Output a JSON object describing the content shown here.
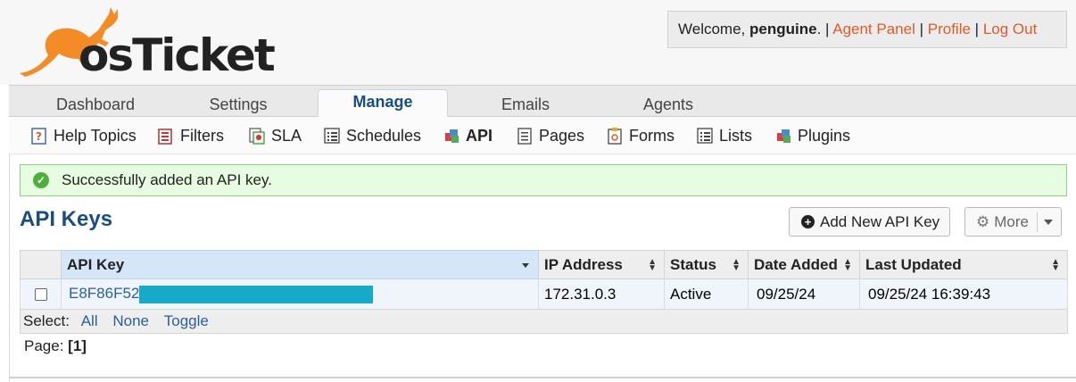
{
  "app": {
    "logo_text": "osTicket"
  },
  "user_box": {
    "welcome": "Welcome, ",
    "username": "penguine",
    "period": ".",
    "sep": " | ",
    "agent_panel": "Agent Panel",
    "profile": "Profile",
    "logout": "Log Out"
  },
  "tabs": [
    {
      "label": "Dashboard",
      "active": false
    },
    {
      "label": "Settings",
      "active": false
    },
    {
      "label": "Manage",
      "active": true
    },
    {
      "label": "Emails",
      "active": false
    },
    {
      "label": "Agents",
      "active": false
    }
  ],
  "subnav": [
    {
      "label": "Help Topics",
      "icon": "help-topics-icon",
      "active": false
    },
    {
      "label": "Filters",
      "icon": "filters-icon",
      "active": false
    },
    {
      "label": "SLA",
      "icon": "sla-icon",
      "active": false
    },
    {
      "label": "Schedules",
      "icon": "schedules-icon",
      "active": false
    },
    {
      "label": "API",
      "icon": "api-icon",
      "active": true
    },
    {
      "label": "Pages",
      "icon": "pages-icon",
      "active": false
    },
    {
      "label": "Forms",
      "icon": "forms-icon",
      "active": false
    },
    {
      "label": "Lists",
      "icon": "lists-icon",
      "active": false
    },
    {
      "label": "Plugins",
      "icon": "plugins-icon",
      "active": false
    }
  ],
  "notice": {
    "message": "Successfully added an API key.",
    "icon": "check-circle-icon"
  },
  "page": {
    "title": "API Keys",
    "add_button": "Add New API Key",
    "more_button": "More"
  },
  "table": {
    "columns": [
      "API Key",
      "IP Address",
      "Status",
      "Date Added",
      "Last Updated"
    ],
    "rows": [
      {
        "api_key_visible": "E8F86F52",
        "api_key_redacted": true,
        "ip_address": "172.31.0.3",
        "status": "Active",
        "date_added": "09/25/24",
        "last_updated": "09/25/24 16:39:43"
      }
    ]
  },
  "select_bar": {
    "label": "Select:",
    "all": "All",
    "none": "None",
    "toggle": "Toggle"
  },
  "pager": {
    "label": "Page:",
    "current": "[1]"
  },
  "colors": {
    "accent": "#184e81",
    "link_orange": "#e05a2a",
    "success_bg": "#e6fde1",
    "success_border": "#8fd180",
    "redaction": "#16a9c9"
  }
}
